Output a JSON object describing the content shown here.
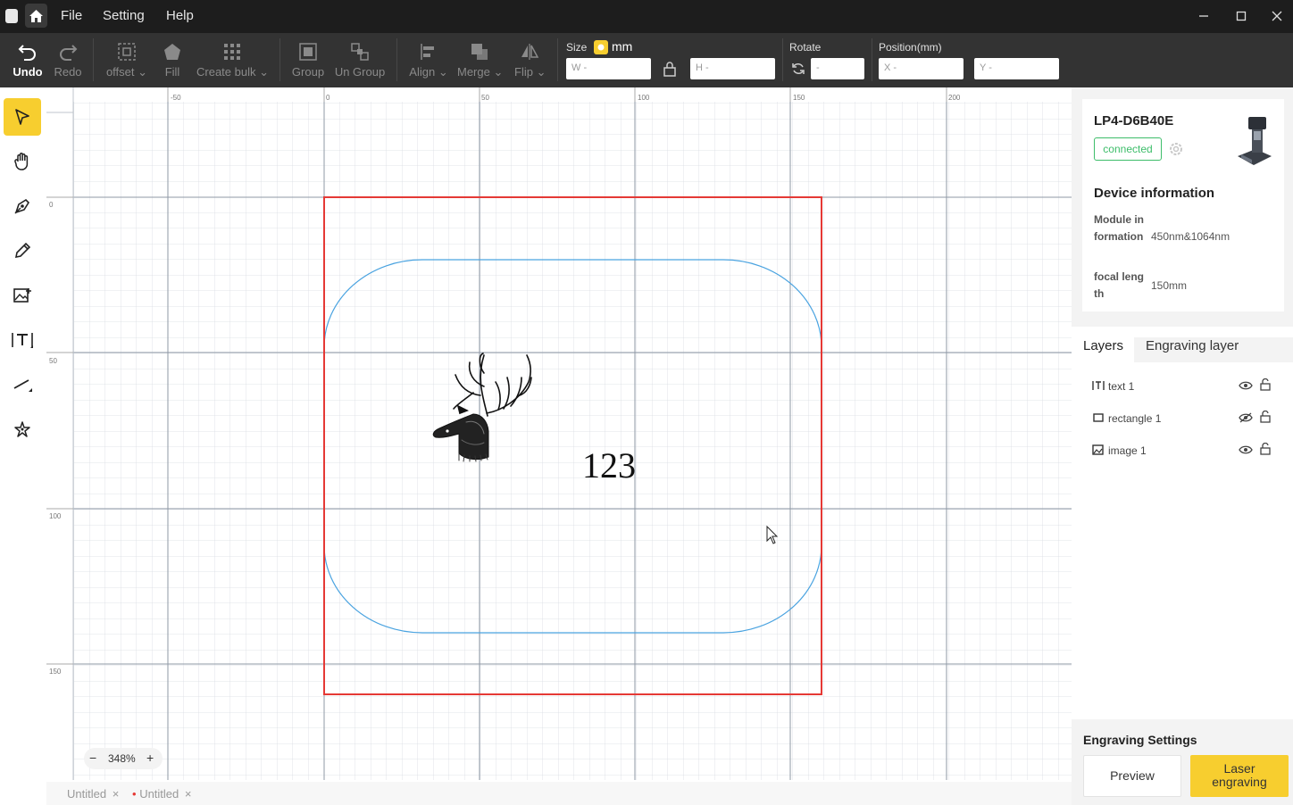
{
  "titlebar": {
    "menus": [
      "File",
      "Setting",
      "Help"
    ],
    "icons": [
      "app-logo-icon",
      "home-icon",
      "minimize-icon",
      "maximize-icon",
      "close-icon"
    ]
  },
  "toolbar": {
    "undo": "Undo",
    "redo": "Redo",
    "offset": "offset",
    "fill": "Fill",
    "create_bulk": "Create bulk",
    "group": "Group",
    "ungroup": "Un Group",
    "align": "Align",
    "merge": "Merge",
    "flip": "Flip",
    "size_label": "Size",
    "size_unit": "mm",
    "w_placeholder": "W -",
    "h_placeholder": "H -",
    "rotate_label": "Rotate",
    "rotate_placeholder": "-",
    "position_label": "Position(mm)",
    "x_placeholder": "X -",
    "y_placeholder": "Y -"
  },
  "left_tools": [
    "select-tool",
    "hand-tool",
    "pen-tool",
    "pencil-tool",
    "add-image-tool",
    "text-tool",
    "line-tool",
    "magic-tool"
  ],
  "canvas": {
    "ruler_x_labels": [
      "-50",
      "0",
      "50",
      "100",
      "150",
      "200"
    ],
    "ruler_y_labels": [
      "0",
      "50",
      "100",
      "150"
    ],
    "text_object": "123",
    "zoom_level": "348%",
    "zoom_minus": "−",
    "zoom_plus": "+"
  },
  "file_tabs": [
    {
      "label": "Untitled",
      "modified": false
    },
    {
      "label": "Untitled",
      "modified": true
    }
  ],
  "device": {
    "name": "LP4-D6B40E",
    "status": "connected",
    "section_title": "Device information",
    "module_label": "Module information",
    "module_value": "450nm&1064nm",
    "focal_label": "focal length",
    "focal_value": "150mm"
  },
  "layers": {
    "tabs": [
      "Layers",
      "Engraving layer"
    ],
    "items": [
      {
        "name": "text 1",
        "icon": "text-layer-icon",
        "visible": true
      },
      {
        "name": "rectangle 1",
        "icon": "rectangle-layer-icon",
        "visible": false
      },
      {
        "name": "image 1",
        "icon": "image-layer-icon",
        "visible": true
      }
    ]
  },
  "engraving": {
    "title": "Engraving Settings",
    "preview": "Preview",
    "laser": "Laser engraving"
  },
  "colors": {
    "accent": "#f7ce2f",
    "selection_red": "#e53935",
    "shape_blue": "#4aa3e0",
    "connected_green": "#3dbd6a"
  }
}
